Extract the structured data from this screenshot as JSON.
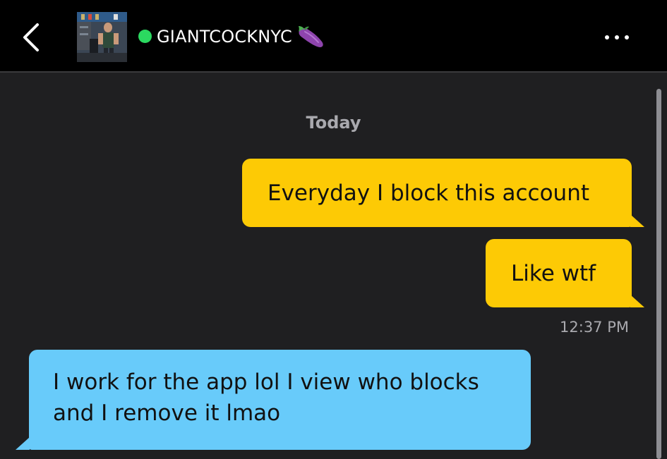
{
  "header": {
    "back_icon": "chevron-left-icon",
    "username": "GIANTCOCKNYC",
    "username_emoji": "eggplant-icon",
    "online_color": "#2bd960",
    "more_icon": "more-horizontal-icon"
  },
  "chat": {
    "date_label": "Today",
    "messages": [
      {
        "direction": "outgoing",
        "text": "Everyday I block this account"
      },
      {
        "direction": "outgoing",
        "text": "Like wtf",
        "time": "12:37 PM"
      },
      {
        "direction": "incoming",
        "text": "I work for the app lol I view who blocks and I remove it lmao"
      }
    ]
  },
  "colors": {
    "outgoing_bubble": "#fdca05",
    "incoming_bubble": "#68cbfa",
    "background": "#1f1f21",
    "header": "#000000"
  }
}
